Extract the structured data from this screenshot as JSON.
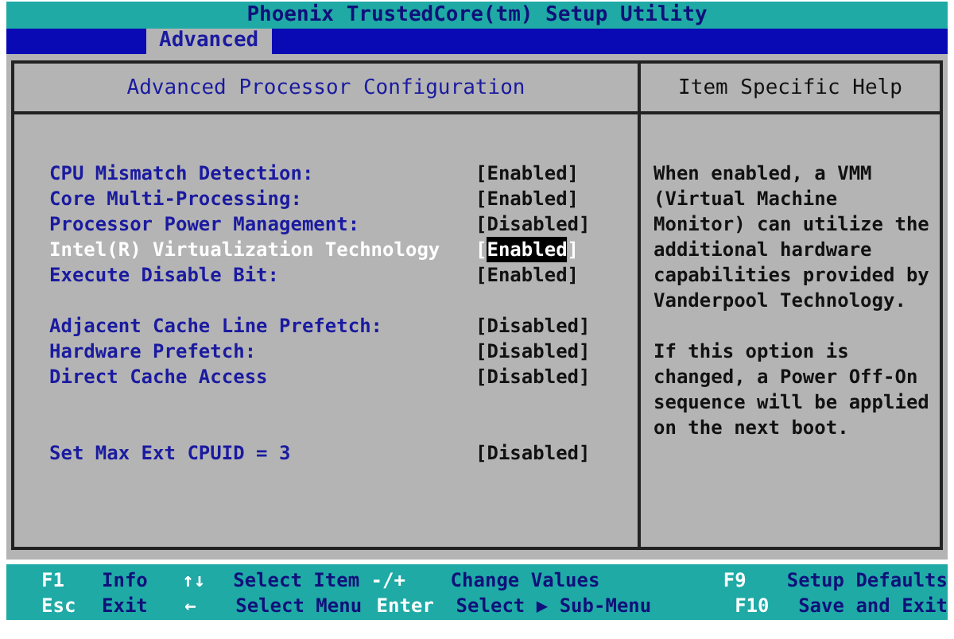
{
  "window": {
    "title": "Phoenix TrustedCore(tm) Setup Utility"
  },
  "tabs": [
    {
      "label": "Advanced",
      "selected": true
    }
  ],
  "panel": {
    "title": "Advanced Processor Configuration",
    "groups": [
      [
        {
          "label": "CPU Mismatch Detection:",
          "value": "[Enabled]",
          "selected": false
        },
        {
          "label": "Core Multi-Processing:",
          "value": "[Enabled]",
          "selected": false
        },
        {
          "label": "Processor Power Management:",
          "value": "[Disabled]",
          "selected": false
        },
        {
          "label": "Intel(R) Virtualization Technology",
          "value": "[Enabled]",
          "selected": true
        },
        {
          "label": "Execute Disable Bit:",
          "value": "[Enabled]",
          "selected": false
        }
      ],
      [
        {
          "label": "Adjacent Cache Line Prefetch:",
          "value": "[Disabled]",
          "selected": false
        },
        {
          "label": "Hardware Prefetch:",
          "value": "[Disabled]",
          "selected": false
        },
        {
          "label": "Direct Cache Access",
          "value": "[Disabled]",
          "selected": false
        }
      ],
      [
        {
          "label": "Set Max Ext CPUID = 3",
          "value": "[Disabled]",
          "selected": false
        }
      ]
    ]
  },
  "help": {
    "title": "Item Specific Help",
    "paragraphs": [
      "When enabled, a VMM (Virtual Machine Monitor) can utilize the additional hardware capabilities provided by Vanderpool Technology.",
      "If this option is changed, a Power Off-On sequence will be applied on the next boot."
    ]
  },
  "status_bar": [
    [
      {
        "key": "F1",
        "action": "Info"
      },
      {
        "key": "↑↓",
        "action": "Select Item"
      },
      {
        "key": "-/+",
        "action": "Change Values"
      },
      {
        "key": "F9",
        "action": "Setup Defaults"
      }
    ],
    [
      {
        "key": "Esc",
        "action": "Exit"
      },
      {
        "key": "←",
        "action": "Select Menu"
      },
      {
        "key": "Enter",
        "action": "Select ▶ Sub-Menu"
      },
      {
        "key": "F10",
        "action": "Save and Exit"
      }
    ]
  ]
}
